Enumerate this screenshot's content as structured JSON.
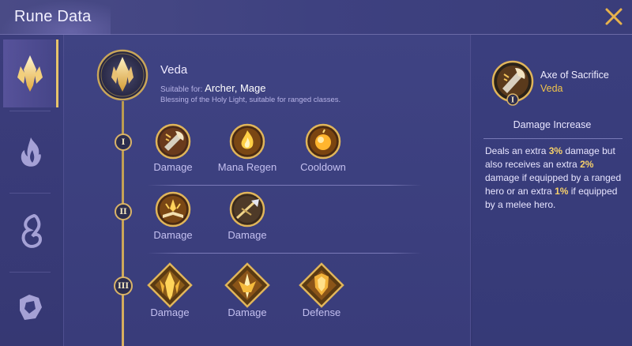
{
  "header": {
    "title": "Rune Data"
  },
  "icons": {
    "close": "close-icon",
    "tabs": [
      "crystal-tab-icon",
      "flame-tab-icon",
      "swirl-tab-icon",
      "shield-tab-icon"
    ]
  },
  "rune_set": {
    "name": "Veda",
    "suitable_label": "Suitable for:",
    "suitable_value": "Archer, Mage",
    "description": "Blessing of the Holy Light, suitable for ranged classes."
  },
  "tiers": [
    {
      "numeral": "I",
      "runes": [
        "Damage",
        "Mana Regen",
        "Cooldown"
      ]
    },
    {
      "numeral": "II",
      "runes": [
        "Damage",
        "Damage"
      ]
    },
    {
      "numeral": "III",
      "runes": [
        "Damage",
        "Damage",
        "Defense"
      ]
    }
  ],
  "detail": {
    "name": "Axe of Sacrifice",
    "set": "Veda",
    "badge": "I",
    "type": "Damage Increase",
    "desc_parts": [
      "Deals an extra ",
      "3%",
      " damage but also receives an extra ",
      "2%",
      " damage if equipped by a ranged hero or an extra ",
      "1%",
      " if equipped by a melee hero."
    ]
  },
  "colors": {
    "accent_gold": "#f1c44a",
    "background": "#3c4080"
  }
}
